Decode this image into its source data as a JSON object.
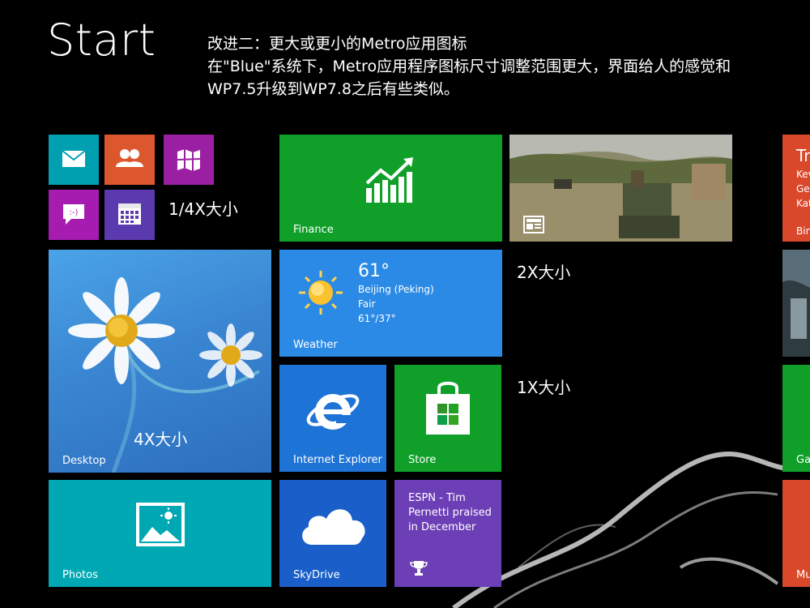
{
  "screen": {
    "title": "Start"
  },
  "note": {
    "line1": "改进二：更大或更小的Metro应用图标",
    "line2": "在\"Blue\"系统下，Metro应用程序图标尺寸调整范围更大，界面给人的感觉和",
    "line3": "WP7.5升级到WP7.8之后有些类似。"
  },
  "size_labels": {
    "quarter": "1/4X大小",
    "double": "2X大小",
    "single": "1X大小",
    "quadruple": "4X大小"
  },
  "tiles": {
    "mail": {
      "color": "#00a0b1",
      "icon": "mail-icon"
    },
    "people": {
      "color": "#dc572e",
      "icon": "people-icon"
    },
    "maps": {
      "color": "#9b1fa2",
      "icon": "map-icon"
    },
    "messaging": {
      "color": "#a61bb0",
      "icon": "chat-icon"
    },
    "calendar": {
      "color": "#5b3ab0",
      "icon": "calendar-icon"
    },
    "finance": {
      "label": "Finance",
      "color": "#10a02a",
      "icon": "chart-growth-icon"
    },
    "news": {
      "icon": "newspaper-icon"
    },
    "desktop": {
      "label": "Desktop",
      "icon": "daisy-wallpaper"
    },
    "weather": {
      "label": "Weather",
      "color": "#2a8ae6",
      "icon": "sun-icon",
      "temp": "61°",
      "city": "Beijing (Peking)",
      "condition": "Fair",
      "range": "61°/37°"
    },
    "ie": {
      "label": "Internet Explorer",
      "color": "#1e73d6",
      "icon": "internet-explorer-icon"
    },
    "store": {
      "label": "Store",
      "color": "#10a02a",
      "icon": "store-bag-icon"
    },
    "photos": {
      "label": "Photos",
      "color": "#00a8b4",
      "icon": "photo-icon"
    },
    "skydrive": {
      "label": "SkyDrive",
      "color": "#1a5fc9",
      "icon": "cloud-icon"
    },
    "espn": {
      "text": "ESPN - Tim Pernetti praised in December",
      "color": "#6c3fb7",
      "icon": "trophy-icon"
    },
    "partial_top": {
      "title": "Tr",
      "line1": "Kev",
      "line2": "Ge",
      "line3": "Kat",
      "line4": "Bin",
      "color": "#d9482a"
    },
    "partial_mid2": {
      "label": "Ga",
      "color": "#10a02a"
    },
    "partial_bottom": {
      "label": "Mu",
      "color": "#d9482a"
    }
  }
}
